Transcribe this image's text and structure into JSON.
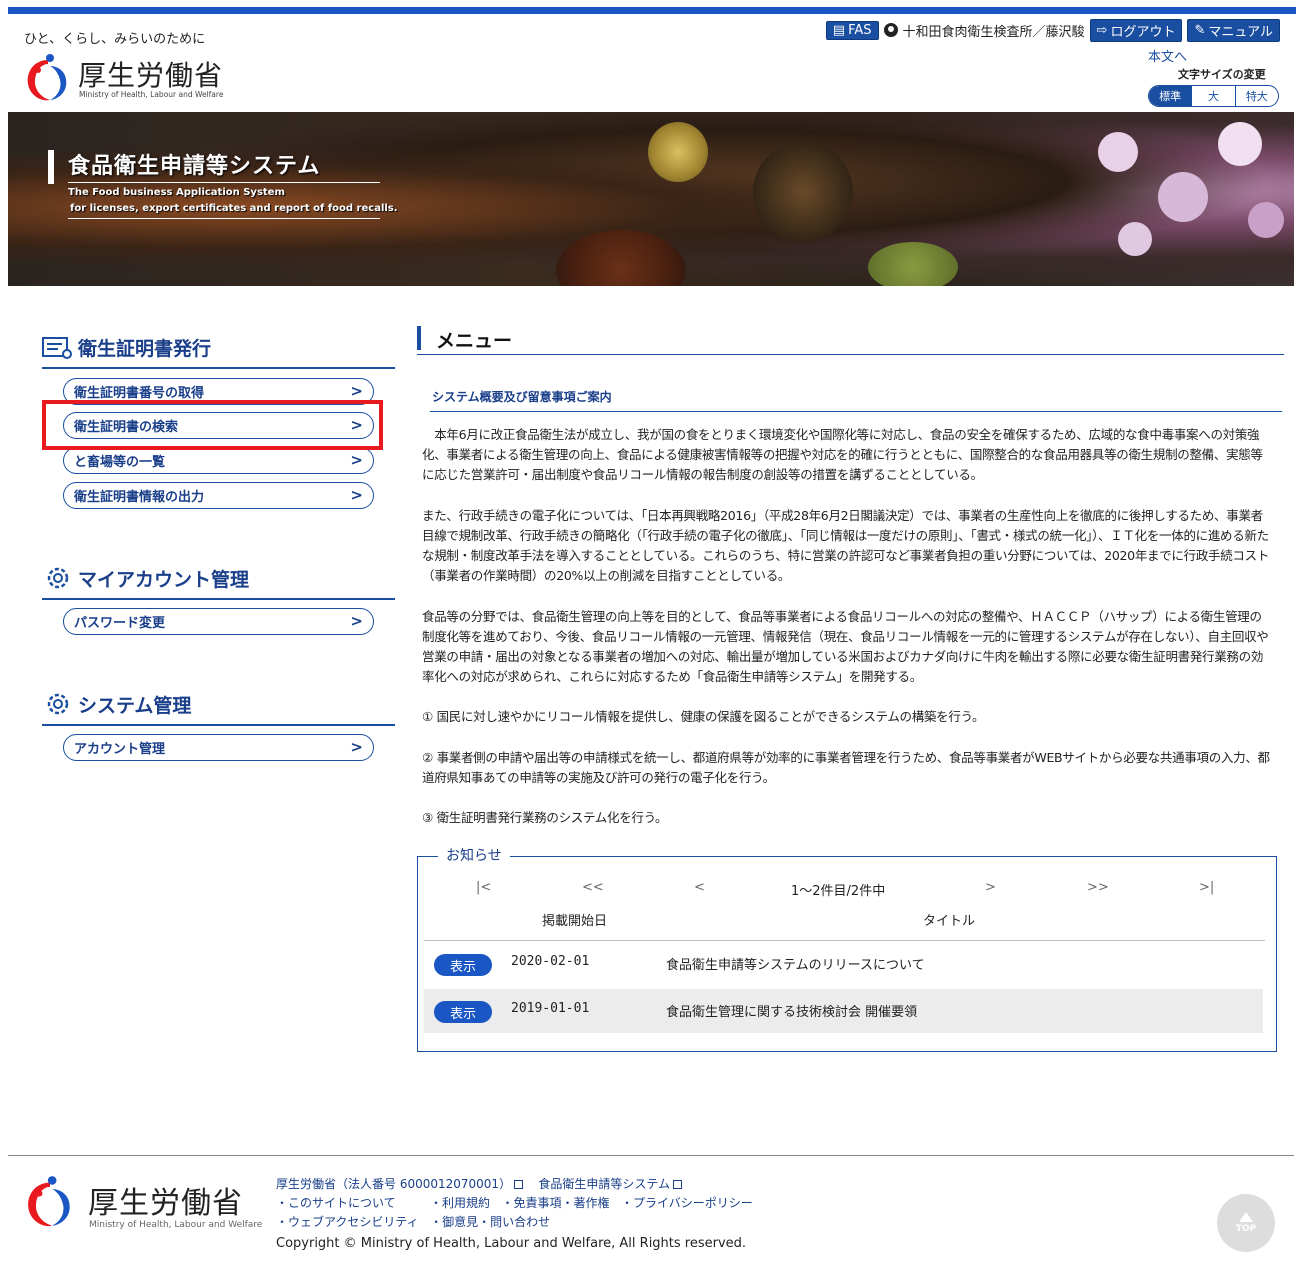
{
  "header": {
    "tagline": "ひと、くらし、みらいのために",
    "logo_jp": "厚生労働省",
    "logo_en": "Ministry of Health, Labour and Welfare",
    "fas_label": "FAS",
    "user_label": "十和田食肉衛生検査所／藤沢駿",
    "logout_label": "ログアウト",
    "manual_label": "マニュアル",
    "skip_link": "本文へ",
    "font_size_label": "文字サイズの変更",
    "font_sizes": [
      "標準",
      "大",
      "特大"
    ]
  },
  "hero": {
    "title": "食品衛生申請等システム",
    "subtitle_line1": "The Food business Application System",
    "subtitle_line2": "for licenses, export certificates and report of food recalls."
  },
  "sidebar": {
    "sections": [
      {
        "title": "衛生証明書発行",
        "items": [
          "衛生証明書番号の取得",
          "衛生証明書の検索",
          "と畜場等の一覧",
          "衛生証明書情報の出力"
        ]
      },
      {
        "title": "マイアカウント管理",
        "items": [
          "パスワード変更"
        ]
      },
      {
        "title": "システム管理",
        "items": [
          "アカウント管理"
        ]
      }
    ]
  },
  "main": {
    "title": "メニュー",
    "sub_heading": "システム概要及び留意事項ご案内",
    "paragraphs": [
      "　本年6月に改正食品衛生法が成立し、我が国の食をとりまく環境変化や国際化等に対応し、食品の安全を確保するため、広域的な食中毒事案への対策強化、事業者による衛生管理の向上、食品による健康被害情報等の把握や対応を的確に行うとともに、国際整合的な食品用器具等の衛生規制の整備、実態等に応じた営業許可・届出制度や食品リコール情報の報告制度の創設等の措置を講ずることとしている。",
      "また、行政手続きの電子化については、「日本再興戦略2016」（平成28年6月2日閣議決定）では、事業者の生産性向上を徹底的に後押しするため、事業者目線で規制改革、行政手続きの簡略化（「行政手続の電子化の徹底」、「同じ情報は一度だけの原則」、「書式・様式の統一化」）、ＩＴ化を一体的に進める新たな規制・制度改革手法を導入することとしている。これらのうち、特に営業の許認可など事業者負担の重い分野については、2020年までに行政手続コスト（事業者の作業時間）の20%以上の削減を目指すこととしている。",
      "食品等の分野では、食品衛生管理の向上等を目的として、食品等事業者による食品リコールへの対応の整備や、ＨＡＣＣＰ（ハサップ）による衛生管理の制度化等を進めており、今後、食品リコール情報の一元管理、情報発信（現在、食品リコール情報を一元的に管理するシステムが存在しない）、自主回収や営業の申請・届出の対象となる事業者の増加への対応、輸出量が増加している米国およびカナダ向けに牛肉を輸出する際に必要な衛生証明書発行業務の効率化への対応が求められ、これらに対応するため「食品衛生申請等システム」を開発する。",
      "① 国民に対し速やかにリコール情報を提供し、健康の保護を図ることができるシステムの構築を行う。",
      "② 事業者側の申請や届出等の申請様式を統一し、都道府県等が効率的に事業者管理を行うため、食品等事業者がWEBサイトから必要な共通事項の入力、都道府県知事あての申請等の実施及び許可の発行の電子化を行う。",
      "③ 衛生証明書発行業務のシステム化を行う。"
    ]
  },
  "notices": {
    "legend": "お知らせ",
    "pager": {
      "first": "|<",
      "prev_page": "<<",
      "prev": "<",
      "range": "1～2件目/2件中",
      "next": ">",
      "next_page": ">>",
      "last": ">|"
    },
    "headers": [
      "掲載開始日",
      "タイトル"
    ],
    "show_label": "表示",
    "rows": [
      {
        "date": "2020-02-01",
        "title": "食品衛生申請等システムのリリースについて"
      },
      {
        "date": "2019-01-01",
        "title": "食品衛生管理に関する技術検討会 開催要領"
      }
    ]
  },
  "footer": {
    "logo_jp": "厚生労働省",
    "logo_en": "Ministry of Health, Labour and Welfare",
    "link_mhlw": "厚生労働省（法人番号 6000012070001）",
    "link_system": "食品衛生申請等システム",
    "links": [
      "・このサイトについて",
      "・利用規約",
      "・免責事項・著作権",
      "・プライバシーポリシー",
      "・ウェブアクセシビリティ",
      "・御意見・問い合わせ"
    ],
    "copyright": "Copyright © Ministry of Health, Labour and Welfare, All Rights reserved.",
    "top_label": "TOP"
  },
  "colors": {
    "brand_blue": "#1a4ea0",
    "highlight_red": "#e8191f"
  }
}
